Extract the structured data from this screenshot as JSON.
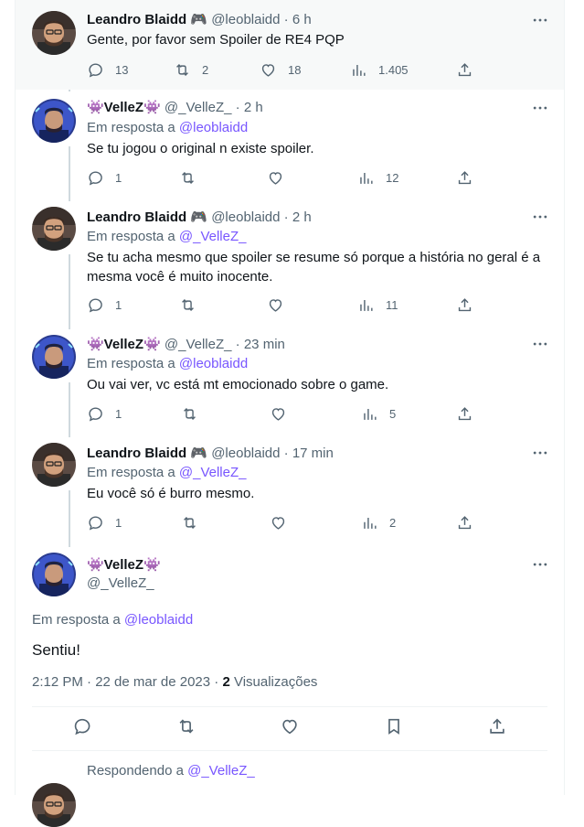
{
  "tweets": [
    {
      "name": "Leandro Blaidd 🎮",
      "handle": "@leoblaidd",
      "time": "6 h",
      "reply_prefix": "",
      "reply_to": "",
      "text": "Gente, por favor sem Spoiler de RE4 PQP",
      "replies": "13",
      "retweets": "2",
      "likes": "18",
      "views": "1.405",
      "avatar": "leandro"
    },
    {
      "name": "👾VelleZ👾",
      "handle": "@_VelleZ_",
      "time": "2 h",
      "reply_prefix": "Em resposta a",
      "reply_to": "@leoblaidd",
      "text": "Se tu jogou o original n existe spoiler.",
      "replies": "1",
      "retweets": "",
      "likes": "",
      "views": "12",
      "avatar": "vellez"
    },
    {
      "name": "Leandro Blaidd 🎮",
      "handle": "@leoblaidd",
      "time": "2 h",
      "reply_prefix": "Em resposta a",
      "reply_to": "@_VelleZ_",
      "text": "Se tu acha mesmo que spoiler se resume só porque a história no geral é a mesma você é muito inocente.",
      "replies": "1",
      "retweets": "",
      "likes": "",
      "views": "11",
      "avatar": "leandro"
    },
    {
      "name": "👾VelleZ👾",
      "handle": "@_VelleZ_",
      "time": "23 min",
      "reply_prefix": "Em resposta a",
      "reply_to": "@leoblaidd",
      "text": "Ou vai ver, vc está mt emocionado sobre o game.",
      "replies": "1",
      "retweets": "",
      "likes": "",
      "views": "5",
      "avatar": "vellez"
    },
    {
      "name": "Leandro Blaidd 🎮",
      "handle": "@leoblaidd",
      "time": "17 min",
      "reply_prefix": "Em resposta a",
      "reply_to": "@_VelleZ_",
      "text": "Eu você só é burro mesmo.",
      "replies": "1",
      "retweets": "",
      "likes": "",
      "views": "2",
      "avatar": "leandro"
    }
  ],
  "main_tweet": {
    "name": "👾VelleZ👾",
    "handle": "@_VelleZ_",
    "reply_prefix": "Em resposta a",
    "reply_to": "@leoblaidd",
    "text": "Sentiu!",
    "timestamp": "2:12 PM · 22 de mar de 2023 · ",
    "views_count": "2",
    "views_label": " Visualizações"
  },
  "reply_box": {
    "prefix": "Respondendo a",
    "handle": "@_VelleZ_"
  },
  "colors": {
    "accent": "#7856ff",
    "muted": "#536471",
    "text": "#0f1419",
    "thread": "#cfd9de"
  },
  "icons": [
    "reply-icon",
    "retweet-icon",
    "like-icon",
    "views-icon",
    "share-icon",
    "bookmark-icon",
    "more-icon"
  ]
}
